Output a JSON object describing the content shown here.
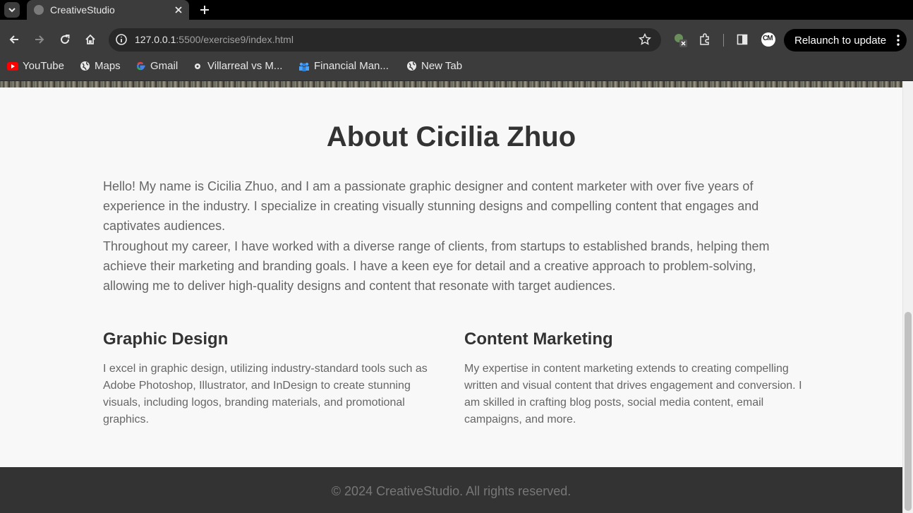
{
  "browser": {
    "tab": {
      "title": "CreativeStudio"
    },
    "url": {
      "host": "127.0.0.1",
      "rest": ":5500/exercise9/index.html"
    },
    "relaunch_label": "Relaunch to update",
    "profile_initials": "CM",
    "bookmarks": [
      {
        "label": "YouTube",
        "icon": "youtube-icon"
      },
      {
        "label": "Maps",
        "icon": "globe-icon"
      },
      {
        "label": "Gmail",
        "icon": "google-icon"
      },
      {
        "label": "Villarreal vs M...",
        "icon": "soccer-icon"
      },
      {
        "label": "Financial Man...",
        "icon": "people-icon"
      },
      {
        "label": "New Tab",
        "icon": "globe-icon"
      }
    ]
  },
  "page": {
    "heading": "About Cicilia Zhuo",
    "intro_p1": "Hello! My name is Cicilia Zhuo, and I am a passionate graphic designer and content marketer with over five years of experience in the industry. I specialize in creating visually stunning designs and compelling content that engages and captivates audiences.",
    "intro_p2": "Throughout my career, I have worked with a diverse range of clients, from startups to established brands, helping them achieve their marketing and branding goals. I have a keen eye for detail and a creative approach to problem-solving, allowing me to deliver high-quality designs and content that resonate with target audiences.",
    "services": [
      {
        "title": "Graphic Design",
        "text": "I excel in graphic design, utilizing industry-standard tools such as Adobe Photoshop, Illustrator, and InDesign to create stunning visuals, including logos, branding materials, and promotional graphics."
      },
      {
        "title": "Content Marketing",
        "text": "My expertise in content marketing extends to creating compelling written and visual content that drives engagement and conversion. I am skilled in crafting blog posts, social media content, email campaigns, and more."
      }
    ],
    "footer": "© 2024 CreativeStudio. All rights reserved."
  },
  "colors": {
    "heading": "#333333",
    "body_text": "#666666",
    "footer_bg": "#333333",
    "footer_text": "#777777"
  }
}
